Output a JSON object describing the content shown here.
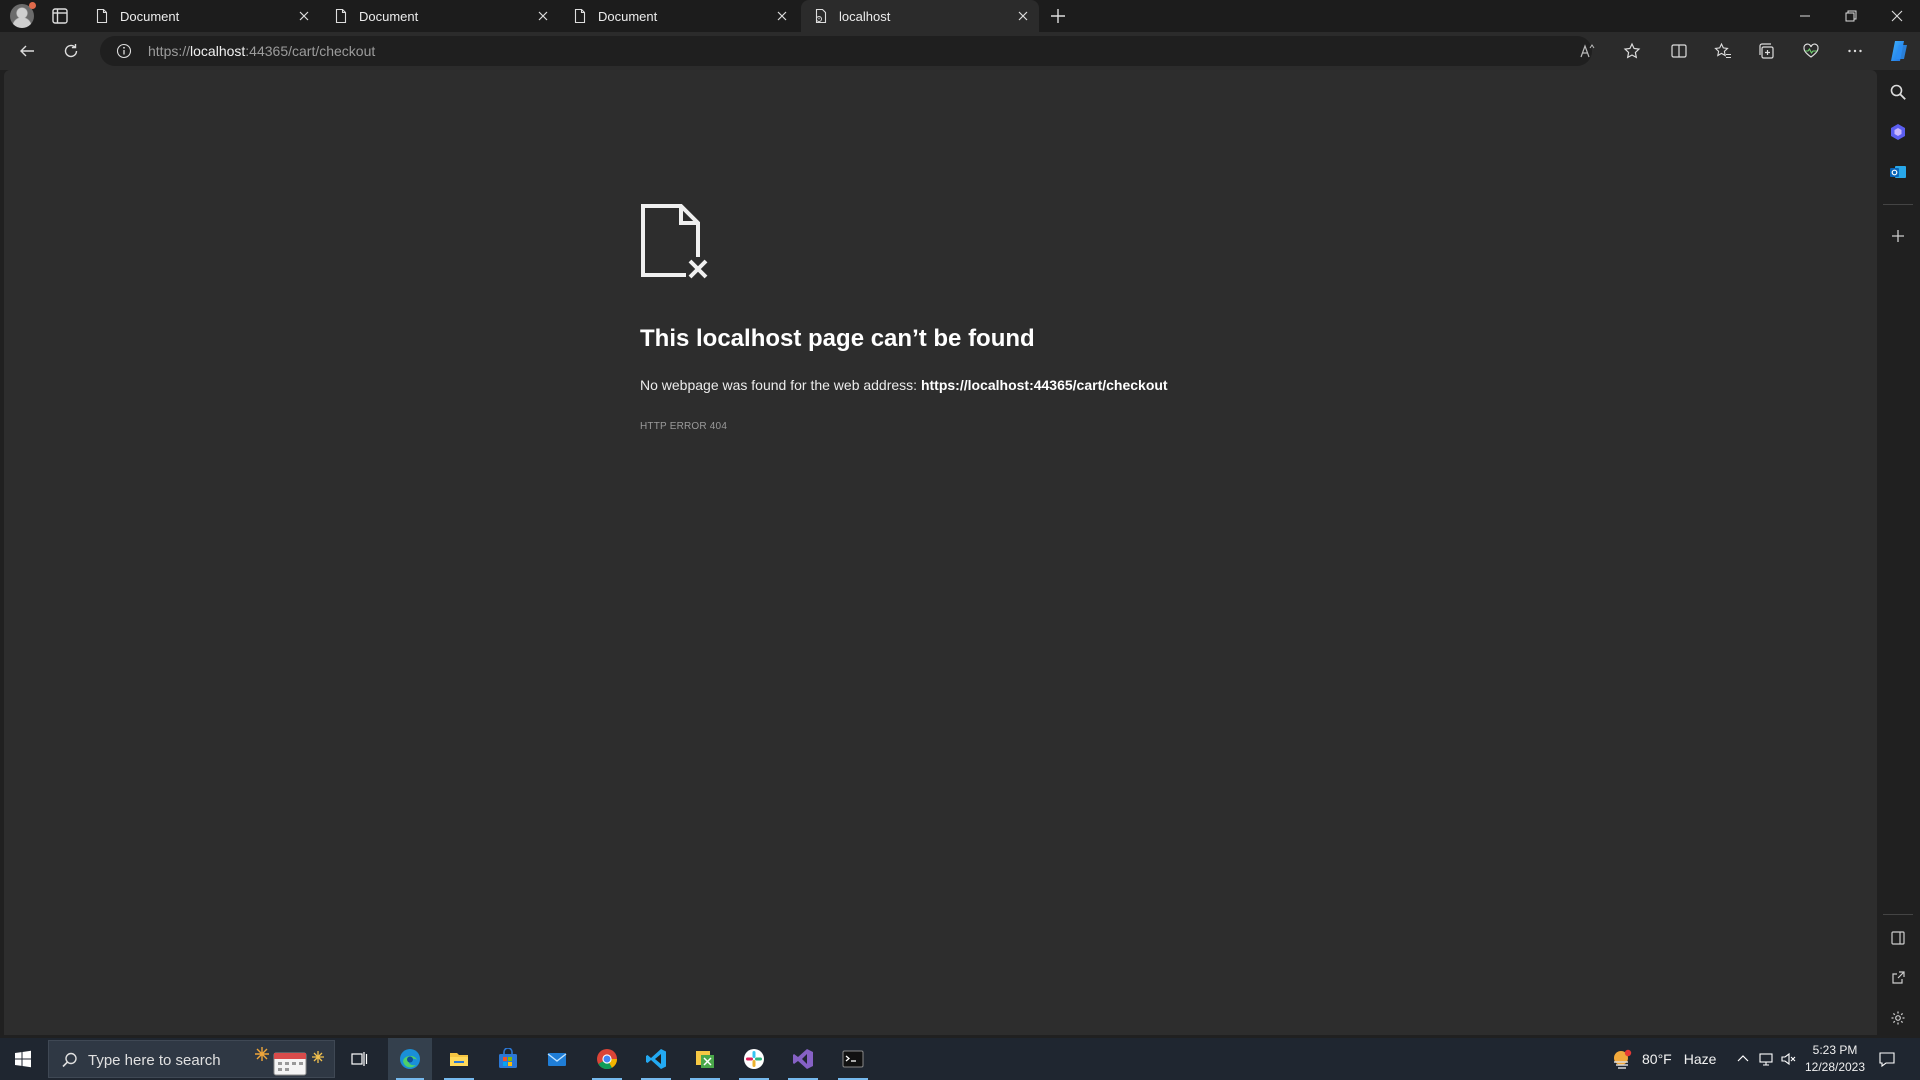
{
  "tabs": [
    {
      "label": "Document",
      "icon": "document-icon"
    },
    {
      "label": "Document",
      "icon": "document-icon"
    },
    {
      "label": "Document",
      "icon": "document-icon"
    },
    {
      "label": "localhost",
      "icon": "page-error-icon"
    }
  ],
  "address_bar": {
    "scheme": "https://",
    "host": "localhost",
    "rest": ":44365/cart/checkout"
  },
  "error_page": {
    "title": "This localhost page can’t be found",
    "message_prefix": "No webpage was found for the web address:",
    "url": "https://localhost:44365/cart/checkout",
    "code": "HTTP ERROR 404"
  },
  "taskbar": {
    "search_placeholder": "Type here to search",
    "apps": [
      "task-view-icon",
      "edge-icon",
      "file-explorer-icon",
      "microsoft-store-icon",
      "mail-icon",
      "chrome-icon",
      "vscode-icon",
      "sticky-app-icon",
      "slack-icon",
      "visual-studio-icon",
      "terminal-icon"
    ]
  },
  "weather": {
    "temp": "80°F",
    "condition": "Haze"
  },
  "clock": {
    "time": "5:23 PM",
    "date": "12/28/2023"
  },
  "colors": {
    "accent": "#76b9ed",
    "page_bg": "#2d2d2d",
    "chrome_bg": "#202020"
  }
}
